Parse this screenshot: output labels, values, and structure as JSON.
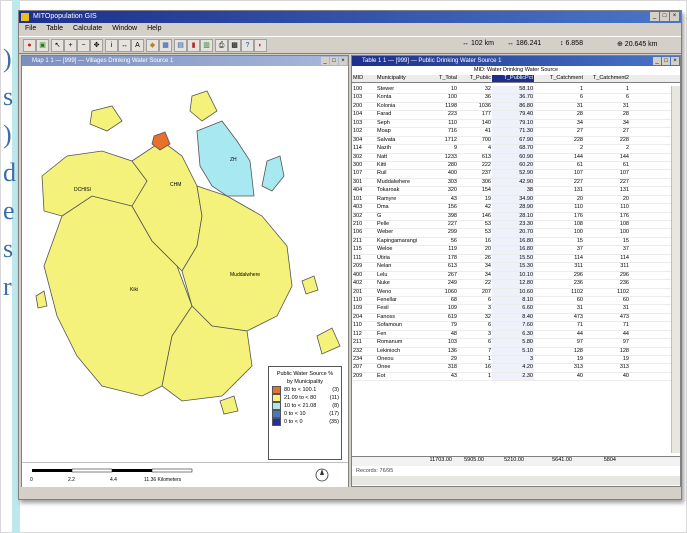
{
  "left_letters": [
    ")",
    "s",
    ")",
    "d",
    "e",
    "s",
    "r"
  ],
  "app": {
    "title": "MITOpopulation GIS",
    "menu": [
      "File",
      "Table",
      "Calculate",
      "Window",
      "Help"
    ],
    "coord_x": "↔ 102 km",
    "coord_y": "↔ 186.241",
    "coord_z": "↕ 6.858",
    "zoom": "⊕ 20.645 km"
  },
  "map_window": {
    "title": "Map 1 1 — [999] — Villages Drinking Water Source 1",
    "labels": {
      "northwest": "DCHISI",
      "center_north": "CHM",
      "northeast": "ZH",
      "east": "Muddalwhere",
      "southwest": "Kiki"
    },
    "scale": {
      "ticks": [
        "0",
        "2.2",
        "4.4",
        "11.36 Kilometers"
      ]
    },
    "legend": {
      "title_line1": "Public Water Source %",
      "title_line2": "by Municipality",
      "rows": [
        {
          "color": "#e8702a",
          "range": "80 to < 100.1",
          "count": "(3)"
        },
        {
          "color": "#f4f27a",
          "range": "21.09 to < 80",
          "count": "(11)"
        },
        {
          "color": "#a8e8f0",
          "range": "10 to < 21.08",
          "count": "(8)"
        },
        {
          "color": "#4a78c8",
          "range": "0 to < 10",
          "count": "(17)"
        },
        {
          "color": "#2030a0",
          "range": "0 to < 0",
          "count": "(35)"
        }
      ]
    }
  },
  "table_window": {
    "title": "Table 1 1 — [999] — Public Drinking Water Source 1",
    "group_header": "MID: Water Drinking Water Source",
    "columns": [
      "MID",
      "Municipality",
      "T_Total",
      "T_Public",
      "T_PublicPct",
      "T_Catchment",
      "T_Catchment2"
    ],
    "rows": [
      [
        "100",
        "Stewer",
        "10",
        "32",
        "58.10",
        "1",
        "1"
      ],
      [
        "103",
        "Konta",
        "100",
        "36",
        "36.70",
        "6",
        "6"
      ],
      [
        "200",
        "Kolonia",
        "1198",
        "1036",
        "86.80",
        "31",
        "31"
      ],
      [
        "104",
        "Farad",
        "223",
        "177",
        "79.40",
        "28",
        "28"
      ],
      [
        "103",
        "Seph",
        "110",
        "140",
        "79.10",
        "34",
        "34"
      ],
      [
        "102",
        "Moap",
        "716",
        "41",
        "71.30",
        "27",
        "27"
      ],
      [
        "304",
        "Salvata",
        "1712",
        "700",
        "67.90",
        "228",
        "228"
      ],
      [
        "114",
        "Nazih",
        "9",
        "4",
        "68.70",
        "2",
        "2"
      ],
      [
        "302",
        "Natt",
        "1233",
        "613",
        "60.90",
        "144",
        "144"
      ],
      [
        "300",
        "Kitti",
        "280",
        "222",
        "60.20",
        "61",
        "61"
      ],
      [
        "107",
        "Ruil",
        "400",
        "237",
        "52.90",
        "107",
        "107"
      ],
      [
        "301",
        "Muddalwhere",
        "303",
        "306",
        "42.90",
        "227",
        "227"
      ],
      [
        "404",
        "Tokaroak",
        "320",
        "154",
        "38",
        "131",
        "131"
      ],
      [
        "101",
        "Ramyre",
        "43",
        "19",
        "34.90",
        "20",
        "20"
      ],
      [
        "403",
        "Dma",
        "156",
        "42",
        "28.90",
        "110",
        "110"
      ],
      [
        "302",
        "G",
        "398",
        "146",
        "28.10",
        "176",
        "176"
      ],
      [
        "210",
        "Pelle",
        "227",
        "53",
        "23.30",
        "108",
        "108"
      ],
      [
        "106",
        "Weber",
        "299",
        "53",
        "20.70",
        "100",
        "100"
      ],
      [
        "211",
        "Kapingamarangi",
        "56",
        "16",
        "16.80",
        "15",
        "15"
      ],
      [
        "115",
        "Weloe",
        "119",
        "20",
        "16.80",
        "37",
        "37"
      ],
      [
        "111",
        "Utiria",
        "178",
        "26",
        "15.50",
        "114",
        "114"
      ],
      [
        "209",
        "Nelan",
        "613",
        "34",
        "15.30",
        "311",
        "311"
      ],
      [
        "400",
        "Lelu",
        "267",
        "34",
        "10.10",
        "296",
        "296"
      ],
      [
        "402",
        "Nuke",
        "249",
        "22",
        "12.80",
        "236",
        "236"
      ],
      [
        "201",
        "Weno",
        "1060",
        "207",
        "10.60",
        "1102",
        "1102"
      ],
      [
        "110",
        "Fenellar",
        "68",
        "6",
        "8.10",
        "60",
        "60"
      ],
      [
        "109",
        "Fesil",
        "109",
        "3",
        "6.60",
        "31",
        "31"
      ],
      [
        "204",
        "Fanoss",
        "619",
        "32",
        "8.40",
        "473",
        "473"
      ],
      [
        "110",
        "Sofamoun",
        "79",
        "6",
        "7.60",
        "71",
        "71"
      ],
      [
        "112",
        "Fen",
        "48",
        "3",
        "6.30",
        "44",
        "44"
      ],
      [
        "211",
        "Romanum",
        "103",
        "6",
        "5.80",
        "97",
        "97"
      ],
      [
        "232",
        "Lekinioch",
        "136",
        "7",
        "5.10",
        "128",
        "128"
      ],
      [
        "234",
        "Oneou",
        "29",
        "1",
        "3",
        "19",
        "19"
      ],
      [
        "207",
        "Onee",
        "318",
        "16",
        "4.20",
        "313",
        "313"
      ],
      [
        "209",
        "Eot",
        "43",
        "1",
        "2.30",
        "40",
        "40"
      ]
    ],
    "totals": [
      "",
      "",
      "11703.00",
      "5905.00",
      "5210.00",
      "5641.00",
      "5804"
    ],
    "status": "Records: 76/95"
  }
}
